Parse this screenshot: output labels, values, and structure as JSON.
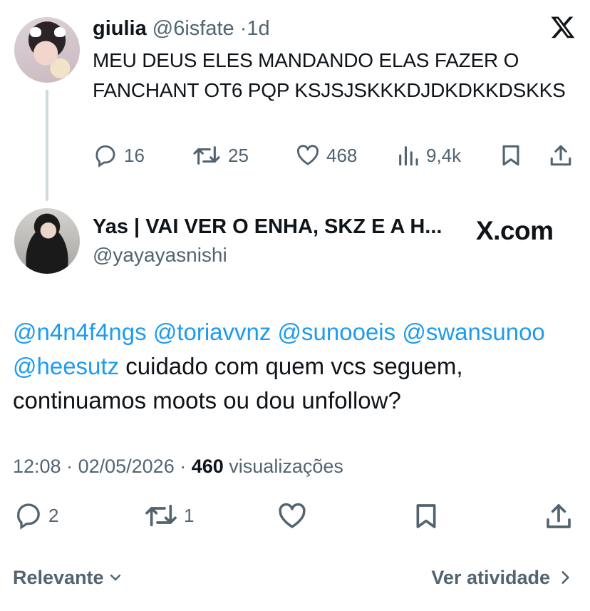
{
  "quoted_tweet": {
    "author_name": "giulia",
    "author_handle": "@6isfate",
    "separator": "·",
    "time_ago": "1d",
    "text": "MEU DEUS ELES MANDANDO ELAS FAZER O FANCHANT OT6 PQP KSJSJSKKKDJDKDKKDSKKS",
    "replies": "16",
    "reposts": "25",
    "likes": "468",
    "views": "9,4k"
  },
  "tweet": {
    "author_name": "Yas | VAI VER O ENHA, SKZ E A H...",
    "author_handle": "@yayayasnishi",
    "watermark": "X.com",
    "mentions": [
      "@n4n4f4ngs",
      "@toriavvnz",
      "@sunooeis",
      "@swansunoo",
      "@heesutz"
    ],
    "body": "cuidado com quem vcs seguem, continuamos moots ou dou unfollow?",
    "time": "12:08",
    "date": "02/05/2026",
    "view_count": "460",
    "view_label": "visualizações",
    "replies": "2",
    "reposts": "1"
  },
  "footer": {
    "sort_label": "Relevante",
    "activity_label": "Ver atividade"
  },
  "colors": {
    "text": "#0f1419",
    "secondary": "#536471",
    "link": "#1d9bf0",
    "thread_line": "#cfd9de"
  },
  "icons": [
    "x-logo-icon",
    "reply-icon",
    "repost-icon",
    "like-icon",
    "views-icon",
    "bookmark-icon",
    "share-icon",
    "chevron-down-icon",
    "chevron-right-icon"
  ]
}
